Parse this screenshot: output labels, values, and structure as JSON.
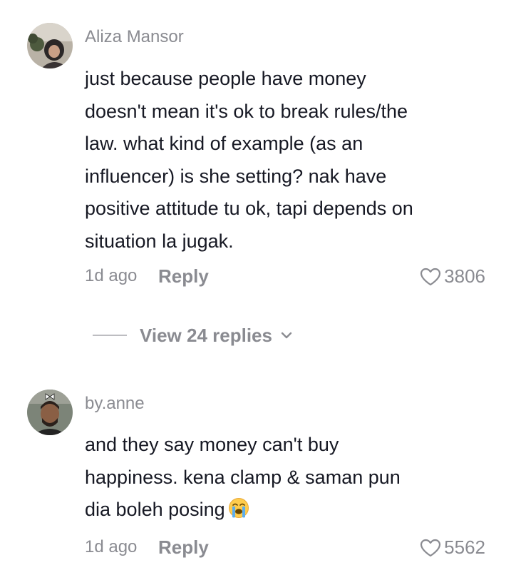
{
  "comments": [
    {
      "username": "Aliza Mansor",
      "avatar_icon": "avatar-photo-woman-hijab",
      "text_lines": [
        "just because people have money",
        "doesn't mean it's ok to break rules/the",
        "law. what kind of example (as an",
        "influencer) is she setting? nak have",
        "positive attitude tu ok, tapi depends on",
        "situation la jugak."
      ],
      "timestamp": "1d ago",
      "reply_label": "Reply",
      "like_icon": "heart-outline-icon",
      "likes": "3806",
      "view_replies_label": "View 24 replies",
      "view_replies_icon": "chevron-down-icon"
    },
    {
      "username": "by.anne",
      "avatar_icon": "avatar-photo-man-bow",
      "text_lines": [
        "and they say money can't buy",
        "happiness. kena clamp & saman pun",
        "dia boleh posing"
      ],
      "emoji": "loudly-crying-face-emoji",
      "timestamp": "1d ago",
      "reply_label": "Reply",
      "like_icon": "heart-outline-icon",
      "likes": "5562"
    }
  ],
  "colors": {
    "text_primary": "#161823",
    "text_secondary": "#8a8b91",
    "divider": "#bdbdc1",
    "background": "#ffffff"
  }
}
